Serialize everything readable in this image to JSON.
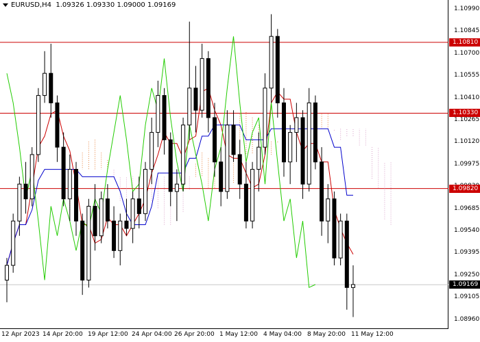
{
  "header": {
    "symbol": "EURUSD,H4",
    "ohlc": "1.09326 1.09330 1.09000 1.09169"
  },
  "price_axis": {
    "ticks": [
      "1.10990",
      "1.10845",
      "1.10700",
      "1.10555",
      "1.10410",
      "1.10265",
      "1.10120",
      "1.09975",
      "1.09830",
      "1.09685",
      "1.09540",
      "1.09395",
      "1.09250",
      "1.09105",
      "1.08960"
    ],
    "levels": [
      {
        "value": "1.10810",
        "color": "#cc0000"
      },
      {
        "value": "1.10330",
        "color": "#cc0000"
      },
      {
        "value": "1.09820",
        "color": "#cc0000"
      }
    ],
    "current": {
      "value": "1.09169",
      "color": "#000000"
    }
  },
  "time_axis": {
    "ticks": [
      "12 Apr 2023",
      "14 Apr 20:00",
      "19 Apr 12:00",
      "24 Apr 04:00",
      "26 Apr 20:00",
      "1 May 12:00",
      "4 May 04:00",
      "8 May 20:00",
      "11 May 12:00"
    ]
  },
  "colors": {
    "candle": "#000000",
    "tenkan": "#cc0000",
    "kijun": "#0000cc",
    "chikou": "#22cc00",
    "cloud": "#e8803a",
    "cloud_alt": "#d9a0c8"
  },
  "chart_data": {
    "type": "candlestick",
    "symbol": "EURUSD",
    "timeframe": "H4",
    "ylim": [
      1.0892,
      1.1105
    ],
    "levels": [
      1.1081,
      1.1033,
      1.0982
    ],
    "last_price": 1.09169,
    "candles": [
      [
        1.092,
        1.0935,
        1.0905,
        1.093
      ],
      [
        1.093,
        1.0965,
        1.0925,
        1.096
      ],
      [
        1.096,
        1.099,
        1.095,
        1.0985
      ],
      [
        1.0985,
        1.1,
        1.0965,
        1.0975
      ],
      [
        1.0975,
        1.101,
        1.097,
        1.1005
      ],
      [
        1.1005,
        1.105,
        1.1,
        1.1045
      ],
      [
        1.1045,
        1.1075,
        1.104,
        1.106
      ],
      [
        1.106,
        1.108,
        1.103,
        1.104
      ],
      [
        1.104,
        1.1045,
        1.1,
        1.101
      ],
      [
        1.101,
        1.102,
        1.097,
        1.0975
      ],
      [
        1.0975,
        1.1005,
        1.096,
        1.0995
      ],
      [
        1.0995,
        1.1,
        1.095,
        1.096
      ],
      [
        1.096,
        1.0965,
        1.091,
        1.092
      ],
      [
        1.092,
        1.0975,
        1.0915,
        1.097
      ],
      [
        1.097,
        1.0985,
        1.094,
        1.095
      ],
      [
        1.095,
        1.098,
        1.0945,
        1.0975
      ],
      [
        1.0975,
        1.0985,
        1.0955,
        1.096
      ],
      [
        1.096,
        1.097,
        1.0935,
        1.094
      ],
      [
        1.094,
        1.0965,
        1.093,
        1.096
      ],
      [
        1.096,
        1.0975,
        1.095,
        1.0955
      ],
      [
        1.0955,
        1.098,
        1.0945,
        1.0975
      ],
      [
        1.0975,
        1.099,
        1.0955,
        1.0965
      ],
      [
        1.0965,
        1.1,
        1.096,
        1.0995
      ],
      [
        1.0995,
        1.103,
        1.0985,
        1.102
      ],
      [
        1.102,
        1.1055,
        1.101,
        1.1045
      ],
      [
        1.1045,
        1.105,
        1.1005,
        1.1015
      ],
      [
        1.1015,
        1.102,
        1.097,
        1.098
      ],
      [
        1.098,
        1.0995,
        1.096,
        1.0985
      ],
      [
        1.0985,
        1.103,
        1.098,
        1.1025
      ],
      [
        1.1025,
        1.1095,
        1.1015,
        1.105
      ],
      [
        1.105,
        1.1065,
        1.102,
        1.1035
      ],
      [
        1.1035,
        1.108,
        1.103,
        1.107
      ],
      [
        1.107,
        1.1075,
        1.102,
        1.103
      ],
      [
        1.103,
        1.104,
        1.099,
        1.1
      ],
      [
        1.1,
        1.101,
        1.097,
        1.098
      ],
      [
        1.098,
        1.1035,
        1.0975,
        1.1025
      ],
      [
        1.1025,
        1.1035,
        1.1,
        1.1005
      ],
      [
        1.1005,
        1.1015,
        1.0975,
        1.0985
      ],
      [
        1.0985,
        1.1,
        1.0955,
        1.096
      ],
      [
        1.096,
        1.1,
        1.0955,
        1.0995
      ],
      [
        1.0995,
        1.102,
        1.098,
        1.101
      ],
      [
        1.101,
        1.106,
        1.1005,
        1.105
      ],
      [
        1.105,
        1.11,
        1.104,
        1.1085
      ],
      [
        1.1085,
        1.109,
        1.103,
        1.104
      ],
      [
        1.104,
        1.105,
        1.099,
        1.1
      ],
      [
        1.1,
        1.1025,
        1.0985,
        1.102
      ],
      [
        1.102,
        1.104,
        1.1,
        1.103
      ],
      [
        1.103,
        1.1035,
        1.0975,
        1.0985
      ],
      [
        1.0985,
        1.105,
        1.098,
        1.104
      ],
      [
        1.104,
        1.1045,
        1.0995,
        1.1
      ],
      [
        1.1,
        1.101,
        1.095,
        1.096
      ],
      [
        1.096,
        1.0985,
        1.0945,
        1.0975
      ],
      [
        1.0975,
        1.098,
        1.093,
        1.0935
      ],
      [
        1.0935,
        1.0965,
        1.093,
        1.096
      ],
      [
        1.096,
        1.0965,
        1.09,
        1.0915
      ],
      [
        1.0915,
        1.093,
        1.0895,
        1.0917
      ]
    ]
  }
}
